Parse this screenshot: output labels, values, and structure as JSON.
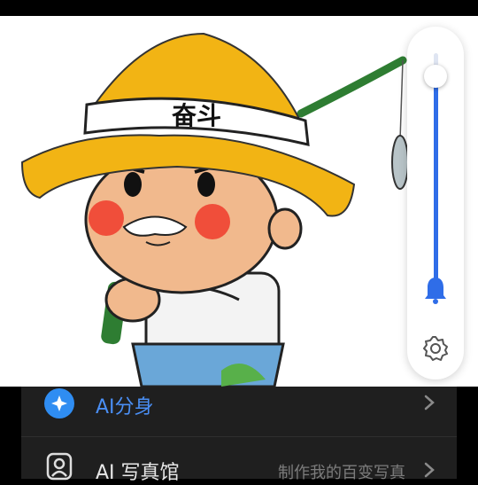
{
  "volume": {
    "level": 0.9,
    "bell_icon": "bell-icon",
    "settings_icon": "gear-icon"
  },
  "artwork": {
    "hat_text": "奋斗"
  },
  "menu": {
    "items": [
      {
        "label": "AI分身",
        "icon": "ai-avatar-icon",
        "subtitle": ""
      },
      {
        "label": "AI 写真馆",
        "icon": "portrait-icon",
        "subtitle": "制作我的百变写真"
      }
    ]
  },
  "colors": {
    "accent": "#2f6de8",
    "list_bg": "#1f1f1f",
    "ai_label": "#4a8ff5"
  }
}
